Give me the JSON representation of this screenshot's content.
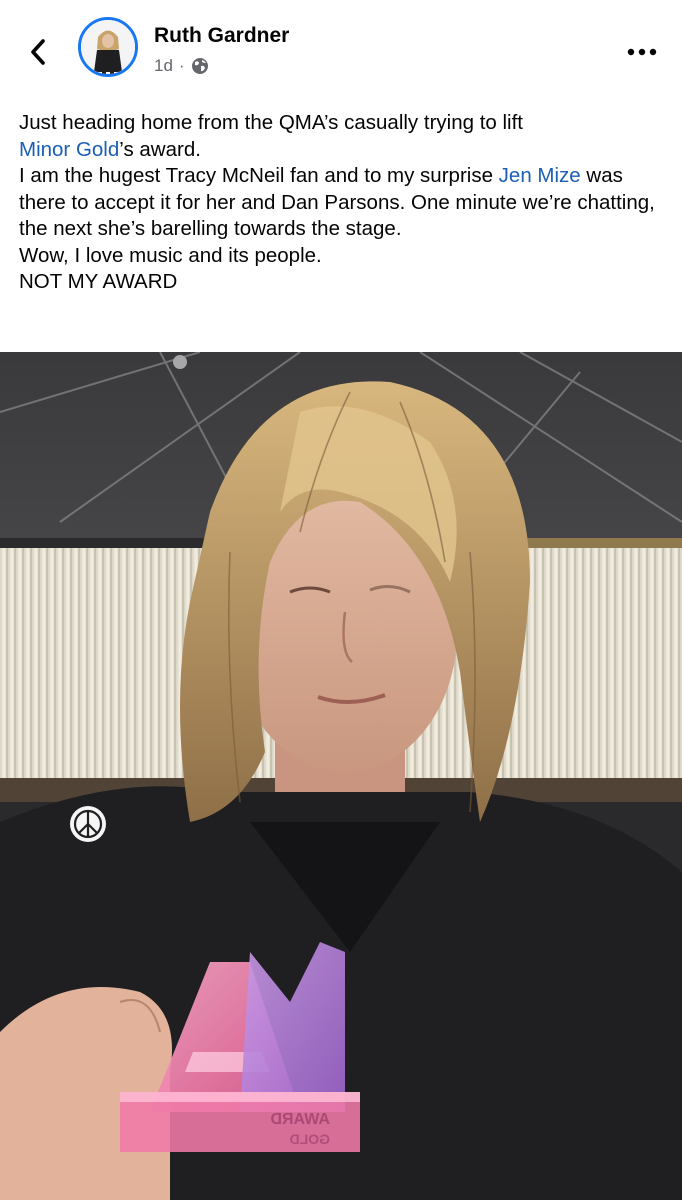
{
  "header": {
    "back_icon": "chevron-left-icon",
    "author_name": "Ruth Gardner",
    "timestamp": "1d",
    "separator": "·",
    "audience_icon": "globe-icon",
    "more_icon": "ellipsis-icon"
  },
  "post": {
    "line1": "Just heading home from the QMA’s casually trying to lift",
    "mention1": "Minor Gold",
    "line2_after": "’s  award.",
    "line3_before": "I am the hugest Tracy McNeil fan and to my surprise ",
    "mention2": "Jen Mize",
    "line3_after": " was there to accept it for her and Dan Parsons. One minute we’re chatting, the next she’s barelling towards the stage.",
    "line4": "Wow, I love music and its people.",
    "line5": "NOT MY AWARD"
  },
  "photo": {
    "trophy_text_1": "AWARD",
    "trophy_text_2": "GOLD",
    "colors": {
      "trophy_pink": "#f07aa8",
      "trophy_purple": "#b07ad8",
      "hair": "#c9a46a",
      "jacket": "#1f1f22"
    }
  },
  "colors": {
    "link": "#1a5fb4",
    "avatar_ring": "#1877f2",
    "meta": "#65676b"
  }
}
